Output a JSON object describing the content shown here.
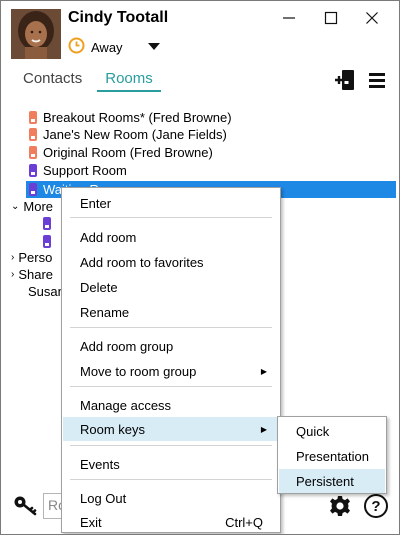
{
  "header": {
    "user_name": "Cindy Tootall",
    "status": "Away"
  },
  "tabs": {
    "contacts": "Contacts",
    "rooms": "Rooms"
  },
  "tree": {
    "rooms": [
      {
        "label": "Breakout Rooms* (Fred Browne)",
        "icon": "orange"
      },
      {
        "label": "Jane's New Room (Jane Fields)",
        "icon": "orange"
      },
      {
        "label": "Original Room (Fred Browne)",
        "icon": "orange"
      },
      {
        "label": "Support Room",
        "icon": "purple"
      },
      {
        "label": "Waiting Room",
        "icon": "purple",
        "selected": true
      }
    ],
    "more_group": "More",
    "personal_group": "Perso",
    "shared_group": "Share",
    "susan_item": "Susan"
  },
  "bottom": {
    "input_value": "Ro"
  },
  "context_menu": {
    "enter": "Enter",
    "add_room": "Add room",
    "add_room_to_favorites": "Add room to favorites",
    "delete": "Delete",
    "rename": "Rename",
    "add_room_group": "Add room group",
    "move_to_room_group": "Move to room group",
    "manage_access": "Manage access",
    "room_keys": "Room keys",
    "events": "Events",
    "log_out": "Log Out",
    "exit": "Exit",
    "exit_shortcut": "Ctrl+Q"
  },
  "room_keys_submenu": {
    "quick": "Quick",
    "presentation": "Presentation",
    "persistent": "Persistent"
  },
  "colors": {
    "accent": "#2a9d9d",
    "selection": "#1e88e5",
    "menu_highlight": "#d8ecf6",
    "room_orange": "#f07d5e",
    "room_purple": "#6b3fd6",
    "status_away": "#f0a020"
  }
}
